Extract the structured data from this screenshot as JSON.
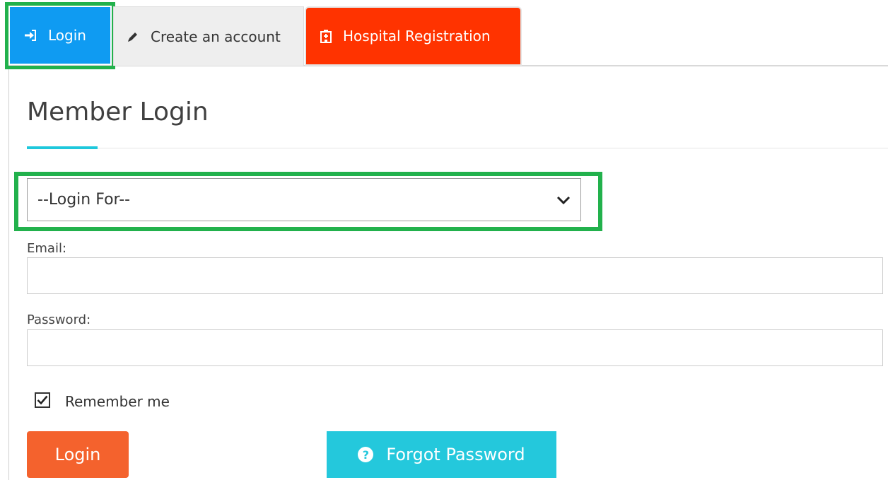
{
  "tabs": {
    "login_label": "Login",
    "create_label": "Create an account",
    "hospital_label": "Hospital Registration"
  },
  "form": {
    "title": "Member Login",
    "login_for_selected": "--Login For--",
    "email_label": "Email:",
    "email_value": "",
    "password_label": "Password:",
    "password_value": "",
    "remember_label": "Remember me",
    "remember_checked": true
  },
  "buttons": {
    "login_label": "Login",
    "forgot_label": "Forgot Password"
  },
  "colors": {
    "login_tab": "#0f9bf2",
    "hospital_tab": "#ff3300",
    "highlight_outline": "#22b14c",
    "accent": "#1ec8dc",
    "login_button": "#f4622d",
    "forgot_button": "#24c8dc"
  },
  "icons": {
    "login_tab": "sign-in-icon",
    "create_tab": "pencil-icon",
    "hospital_tab": "hospital-icon",
    "select": "chevron-down-icon",
    "forgot": "question-circle-icon"
  }
}
